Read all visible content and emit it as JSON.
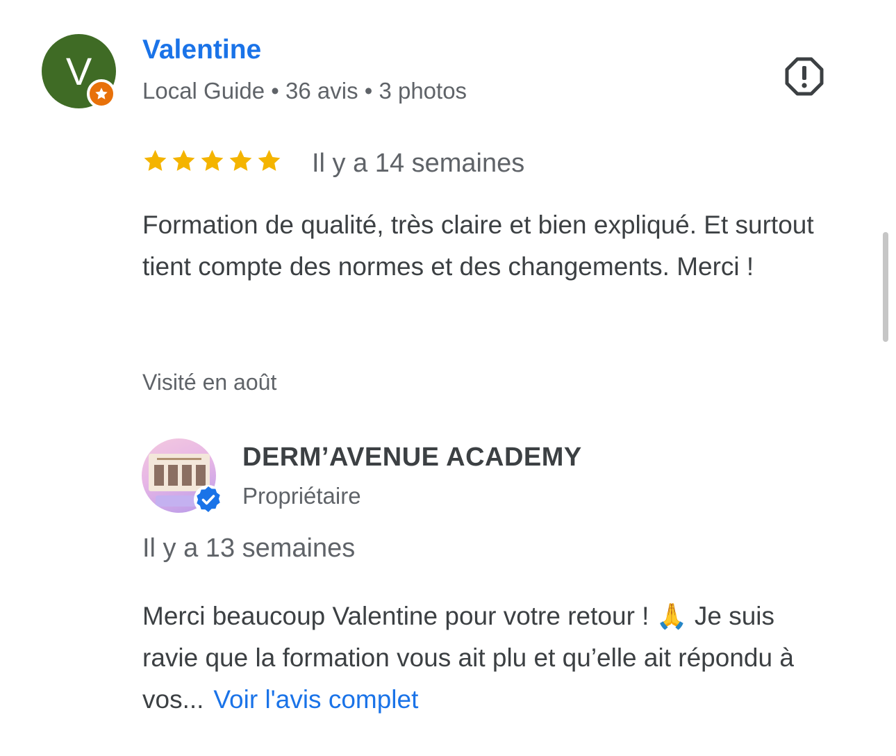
{
  "review": {
    "avatar_letter": "V",
    "reviewer_name": "Valentine",
    "meta": "Local Guide • 36 avis • 3 photos",
    "rating": 5,
    "time_ago": "Il y a 14 semaines",
    "text": "Formation de qualité, très claire et bien expliqué. Et surtout tient compte des normes et des changements. Merci !",
    "visited": "Visité en août",
    "icons": {
      "badge": "local-guide-star-icon",
      "report": "report-flag-icon"
    }
  },
  "owner_reply": {
    "name": "DERM’AVENUE ACADEMY",
    "role": "Propriétaire",
    "time_ago": "Il y a 13 semaines",
    "text_before_emoji": "Merci beaucoup Valentine pour votre retour ! ",
    "emoji": "🙏",
    "text_after_emoji": " Je suis ravie que la formation vous ait plu et qu’elle ait répondu à vos...",
    "more_link": "Voir l'avis complet",
    "icons": {
      "verified": "verified-check-icon"
    }
  },
  "colors": {
    "link": "#1a73e8",
    "star": "#f4b400",
    "avatar": "#3f6b25",
    "guide_badge": "#e8710a",
    "text": "#3c4043",
    "secondary": "#5f6368"
  }
}
